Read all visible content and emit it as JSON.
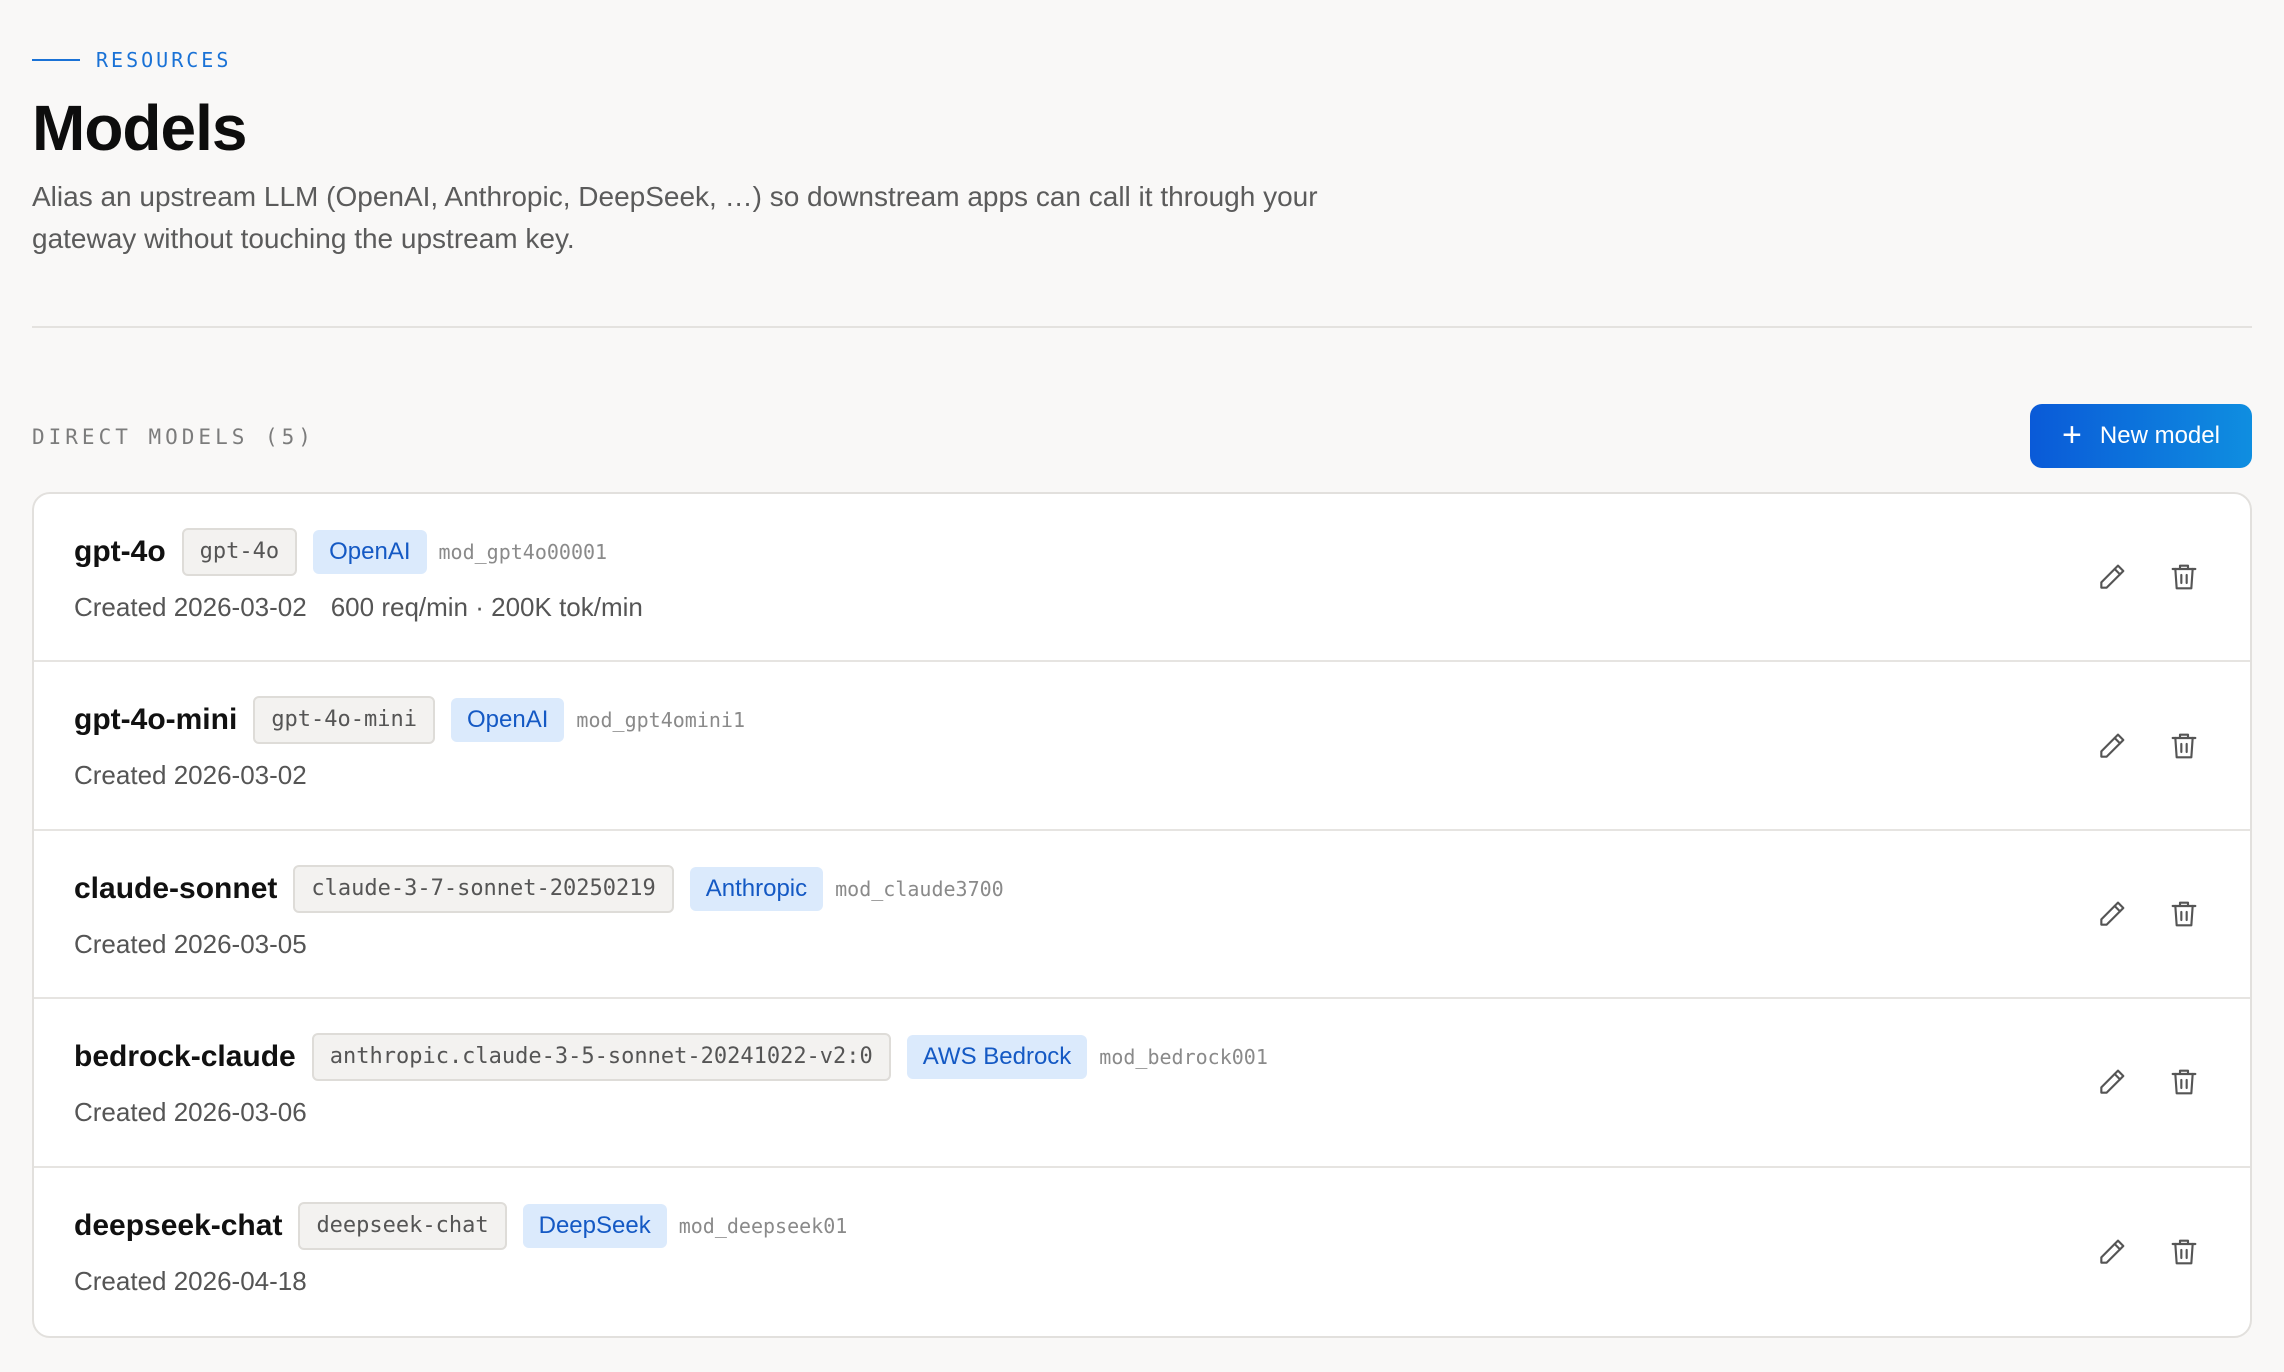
{
  "header": {
    "eyebrow": "RESOURCES",
    "title": "Models",
    "subtitle": "Alias an upstream LLM (OpenAI, Anthropic, DeepSeek, …) so downstream apps can call it through your gateway without touching the upstream key."
  },
  "section": {
    "label": "DIRECT MODELS (5)",
    "new_button_label": "New model"
  },
  "models": [
    {
      "name": "gpt-4o",
      "upstream": "gpt-4o",
      "provider": "OpenAI",
      "id": "mod_gpt4o00001",
      "created": "Created 2026-03-02",
      "limits": "600 req/min · 200K tok/min"
    },
    {
      "name": "gpt-4o-mini",
      "upstream": "gpt-4o-mini",
      "provider": "OpenAI",
      "id": "mod_gpt4omini1",
      "created": "Created 2026-03-02",
      "limits": ""
    },
    {
      "name": "claude-sonnet",
      "upstream": "claude-3-7-sonnet-20250219",
      "provider": "Anthropic",
      "id": "mod_claude3700",
      "created": "Created 2026-03-05",
      "limits": ""
    },
    {
      "name": "bedrock-claude",
      "upstream": "anthropic.claude-3-5-sonnet-20241022-v2:0",
      "provider": "AWS Bedrock",
      "id": "mod_bedrock001",
      "created": "Created 2026-03-06",
      "limits": ""
    },
    {
      "name": "deepseek-chat",
      "upstream": "deepseek-chat",
      "provider": "DeepSeek",
      "id": "mod_deepseek01",
      "created": "Created 2026-04-18",
      "limits": ""
    }
  ],
  "icons": {
    "edit": "pencil-icon",
    "delete": "trash-icon",
    "add": "plus-icon"
  },
  "colors": {
    "accent": "#1a72d6",
    "button_start": "#0a5ad8",
    "button_end": "#0f8ee0",
    "provider_bg": "#dbeafc",
    "provider_text": "#1459c4"
  }
}
